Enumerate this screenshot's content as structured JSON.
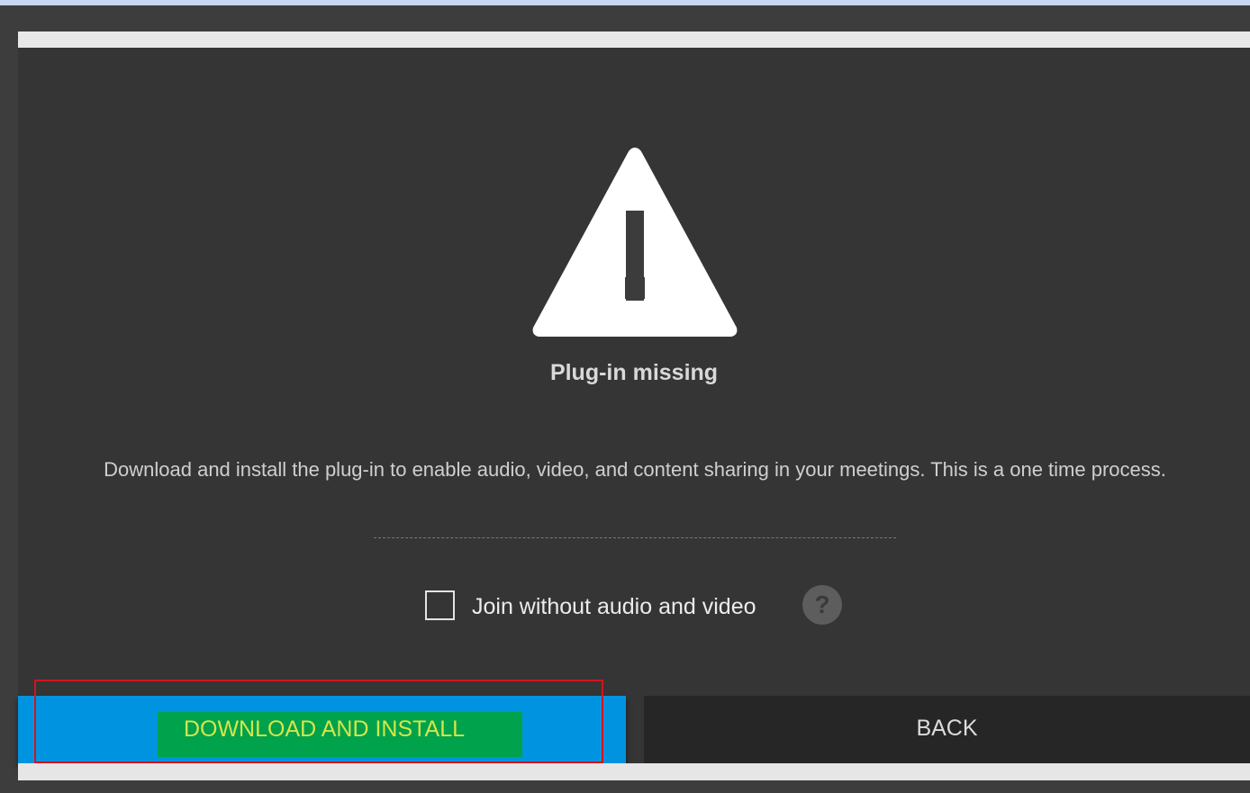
{
  "dialog": {
    "title": "Plug-in missing",
    "description": "Download and install the plug-in to enable audio, video, and content sharing in your meetings. This is a one time process.",
    "checkbox": {
      "label": "Join without audio and video",
      "checked": false
    },
    "help_icon": {
      "icon": "question-circle-icon",
      "glyph": "?"
    },
    "warning_icon": "warning-triangle-icon",
    "buttons": {
      "download_label": "DOWNLOAD AND INSTALL",
      "back_label": "BACK"
    }
  },
  "colors": {
    "dialog_background": "#353535",
    "download_button": "#0094e0",
    "download_label_highlight": "#00a24b",
    "back_button": "#262626",
    "annotation_outline": "#d0151f"
  }
}
